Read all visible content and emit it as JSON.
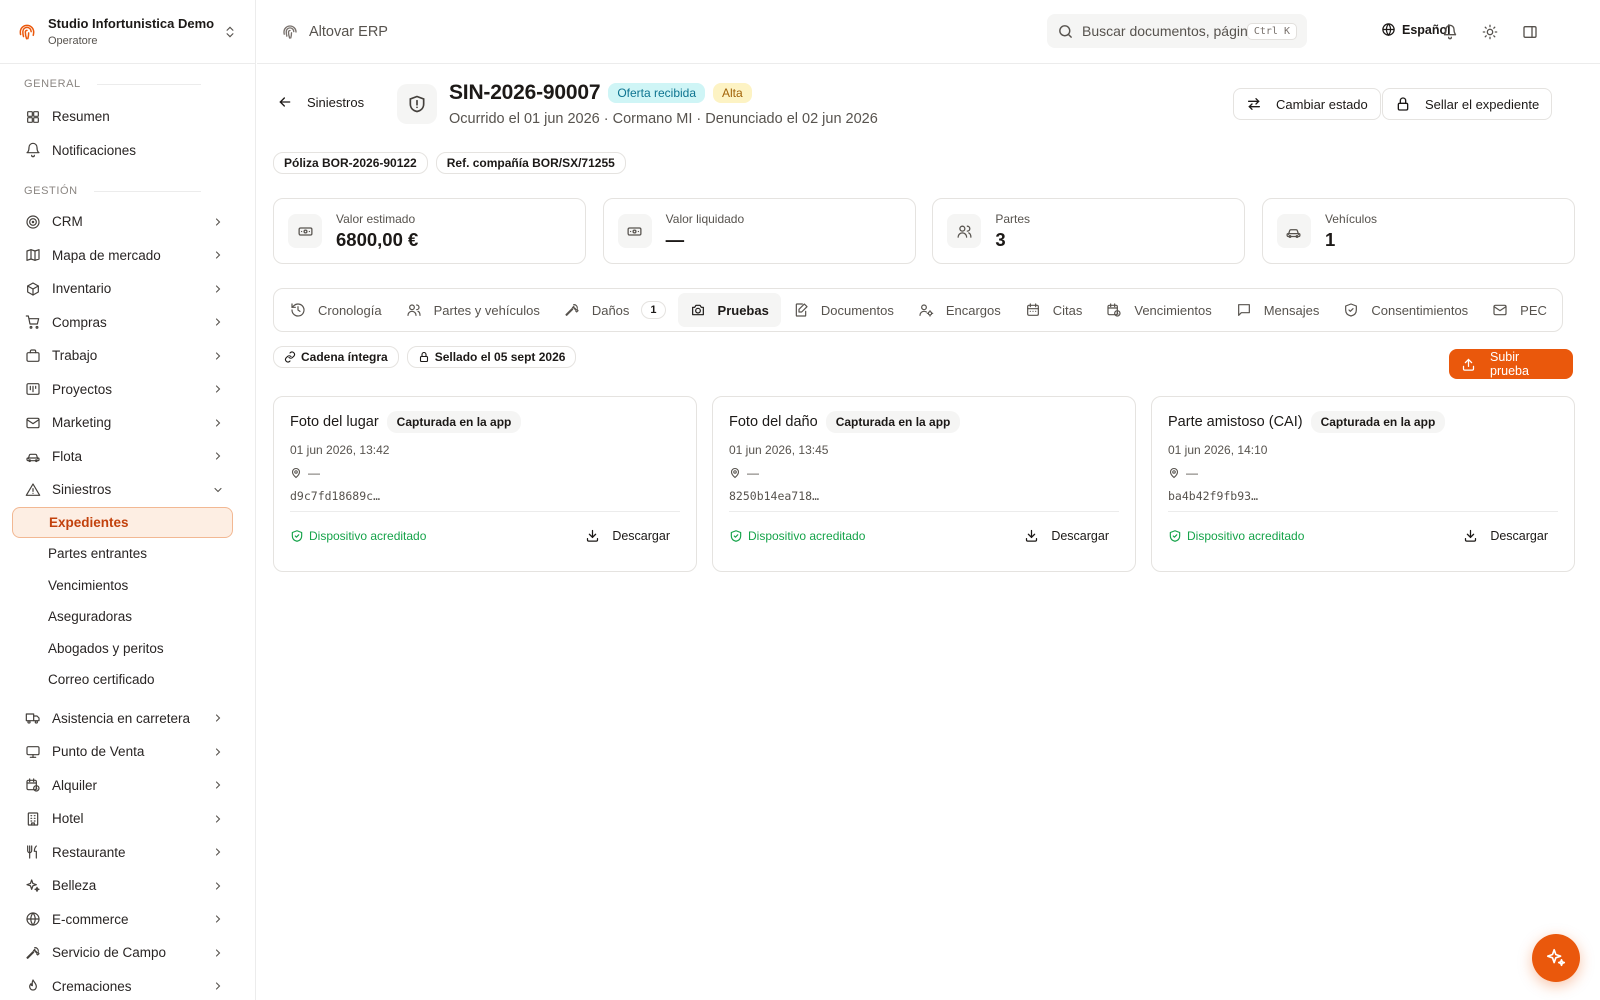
{
  "org": {
    "name": "Studio Infortunistica Demo",
    "role": "Operatore"
  },
  "sidebar": {
    "section_general": "GENERAL",
    "general_items": [
      {
        "label": "Resumen",
        "icon": "grid-icon"
      },
      {
        "label": "Notificaciones",
        "icon": "bell-icon"
      }
    ],
    "section_management": "GESTIÓN",
    "items": [
      {
        "label": "CRM",
        "icon": "target-icon"
      },
      {
        "label": "Mapa de mercado",
        "icon": "map-icon"
      },
      {
        "label": "Inventario",
        "icon": "package-icon"
      },
      {
        "label": "Compras",
        "icon": "cart-icon"
      },
      {
        "label": "Trabajo",
        "icon": "briefcase-icon"
      },
      {
        "label": "Proyectos",
        "icon": "kanban-icon"
      },
      {
        "label": "Marketing",
        "icon": "mail-icon"
      },
      {
        "label": "Flota",
        "icon": "car-icon"
      },
      {
        "label": "Siniestros",
        "icon": "warning-icon"
      }
    ],
    "siniestros_sub": [
      {
        "label": "Expedientes",
        "active": true
      },
      {
        "label": "Partes entrantes"
      },
      {
        "label": "Vencimientos"
      },
      {
        "label": "Aseguradoras"
      },
      {
        "label": "Abogados y peritos"
      },
      {
        "label": "Correo certificado"
      }
    ],
    "items_after": [
      {
        "label": "Asistencia en carretera",
        "icon": "truck-icon"
      },
      {
        "label": "Punto de Venta",
        "icon": "monitor-icon"
      },
      {
        "label": "Alquiler",
        "icon": "calendar-clock-icon"
      },
      {
        "label": "Hotel",
        "icon": "building-icon"
      },
      {
        "label": "Restaurante",
        "icon": "utensils-icon"
      },
      {
        "label": "Belleza",
        "icon": "sparkles-icon"
      },
      {
        "label": "E-commerce",
        "icon": "globe-icon"
      },
      {
        "label": "Servicio de Campo",
        "icon": "wrench-icon"
      },
      {
        "label": "Cremaciones",
        "icon": "flame-icon"
      }
    ]
  },
  "topbar": {
    "app_name": "Altovar ERP",
    "search_placeholder": "Buscar documentos, páginas...",
    "search_shortcut": "Ctrl K",
    "language": "Español"
  },
  "case": {
    "back_label": "Siniestros",
    "id": "SIN-2026-90007",
    "status_badge": "Oferta recibida",
    "priority_badge": "Alta",
    "subtitle": "Ocurrido el 01 jun 2026 · Cormano MI · Denunciado el 02 jun 2026",
    "btn_change_state": "Cambiar estado",
    "btn_seal": "Sellar el expediente",
    "policy_chip": "Póliza BOR-2026-90122",
    "company_ref_chip": "Ref. compañía BOR/SX/71255"
  },
  "stats": [
    {
      "label": "Valor estimado",
      "value": "6800,00 €",
      "icon": "banknote-icon"
    },
    {
      "label": "Valor liquidado",
      "value": "—",
      "icon": "banknote-icon"
    },
    {
      "label": "Partes",
      "value": "3",
      "icon": "users-icon"
    },
    {
      "label": "Vehículos",
      "value": "1",
      "icon": "car-icon"
    }
  ],
  "tabs": [
    {
      "label": "Cronología",
      "icon": "history-icon"
    },
    {
      "label": "Partes y vehículos",
      "icon": "users-icon"
    },
    {
      "label": "Daños",
      "icon": "wrench-icon",
      "count": "1"
    },
    {
      "label": "Pruebas",
      "icon": "camera-icon",
      "active": true
    },
    {
      "label": "Documentos",
      "icon": "file-edit-icon"
    },
    {
      "label": "Encargos",
      "icon": "user-cog-icon"
    },
    {
      "label": "Citas",
      "icon": "calendar-icon"
    },
    {
      "label": "Vencimientos",
      "icon": "calendar-clock-icon"
    },
    {
      "label": "Mensajes",
      "icon": "message-icon"
    },
    {
      "label": "Consentimientos",
      "icon": "shield-check-icon"
    },
    {
      "label": "PEC",
      "icon": "mail-icon"
    }
  ],
  "evidence": {
    "chain_chip": "Cadena íntegra",
    "sealed_chip": "Sellado el 05 sept 2026",
    "upload_button": "Subir prueba",
    "cards": [
      {
        "title": "Foto del lugar",
        "badge": "Capturada en la app",
        "date": "01 jun 2026, 13:42",
        "location": "—",
        "hash": "d9c7fd18689c…",
        "verified": "Dispositivo acreditado",
        "download": "Descargar"
      },
      {
        "title": "Foto del daño",
        "badge": "Capturada en la app",
        "date": "01 jun 2026, 13:45",
        "location": "—",
        "hash": "8250b14ea718…",
        "verified": "Dispositivo acreditado",
        "download": "Descargar"
      },
      {
        "title": "Parte amistoso (CAI)",
        "badge": "Capturada en la app",
        "date": "01 jun 2026, 14:10",
        "location": "—",
        "hash": "ba4b42f9fb93…",
        "verified": "Dispositivo acreditado",
        "download": "Descargar"
      }
    ]
  },
  "colors": {
    "accent": "#ea580c",
    "accent_soft": "#fdeee3",
    "success": "#16a34a",
    "cyan_badge": "#cff5f6",
    "yellow_badge": "#fdf3c4"
  }
}
